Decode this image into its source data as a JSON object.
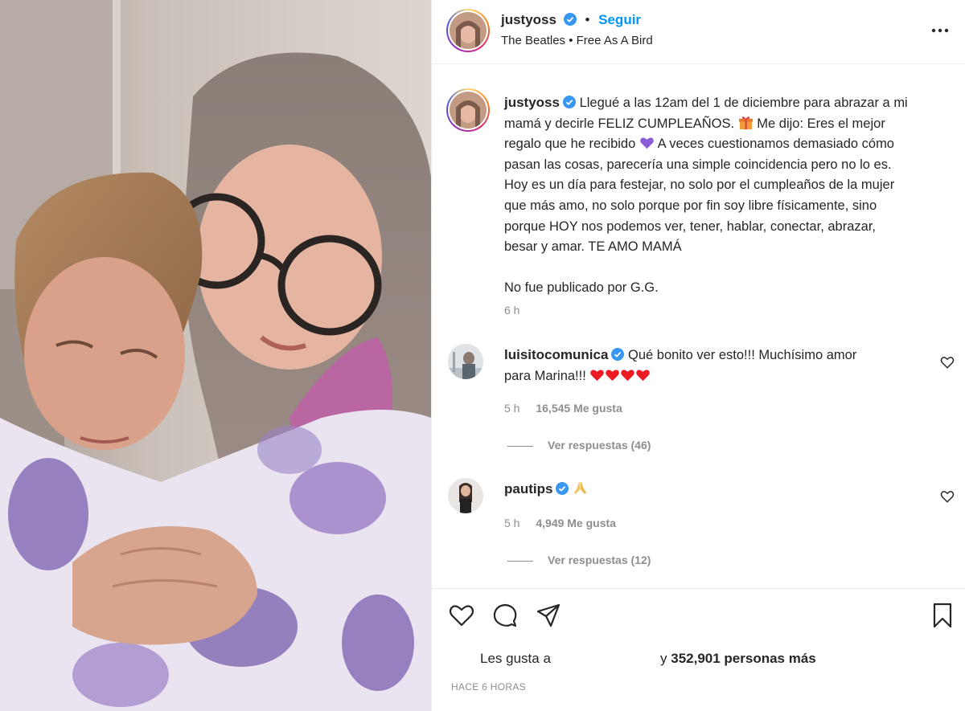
{
  "post": {
    "username": "justyoss",
    "follow_label": "Seguir",
    "music": "The Beatles • Free As A Bird",
    "more_icon": "more-options-icon"
  },
  "caption": {
    "username": "justyoss",
    "lines": [
      "Llegué a las 12am del 1 de diciembre para abrazar a mi",
      "mamá y decirle FELIZ CUMPLEAÑOS.",
      "Me dijo: Eres el mejor",
      "regalo que he recibido",
      "A veces cuestionamos demasiado cómo",
      "pasan las cosas, parecería una simple coincidencia pero no lo es.",
      "Hoy es un día para festejar, no solo por el cumpleaños de la mujer",
      "que más amo, no solo porque por fin soy libre físicamente, sino",
      "porque HOY nos podemos ver, tener, hablar, conectar, abrazar,",
      "besar y amar. TE AMO MAMÁ"
    ],
    "signature": "No fue publicado por G.G.",
    "time": "6 h"
  },
  "comments": [
    {
      "username": "luisitocomunica",
      "text_line1": "Qué bonito ver esto!!! Muchísimo amor",
      "text_line2": "para Marina!!!",
      "time": "5 h",
      "likes": "16,545 Me gusta",
      "replies": "Ver respuestas (46)"
    },
    {
      "username": "pautips",
      "time": "5 h",
      "likes": "4,949 Me gusta",
      "replies": "Ver respuestas (12)"
    }
  ],
  "footer": {
    "likes_prefix": "Les gusta a",
    "likes_suffix_pre": "y",
    "likes_count": "352,901 personas más",
    "posted": "HACE 6 HORAS"
  },
  "colors": {
    "accent": "#0095f6",
    "verified": "#3897f0",
    "heart_red": "#ed1c24",
    "muted": "#8e8e8e"
  }
}
